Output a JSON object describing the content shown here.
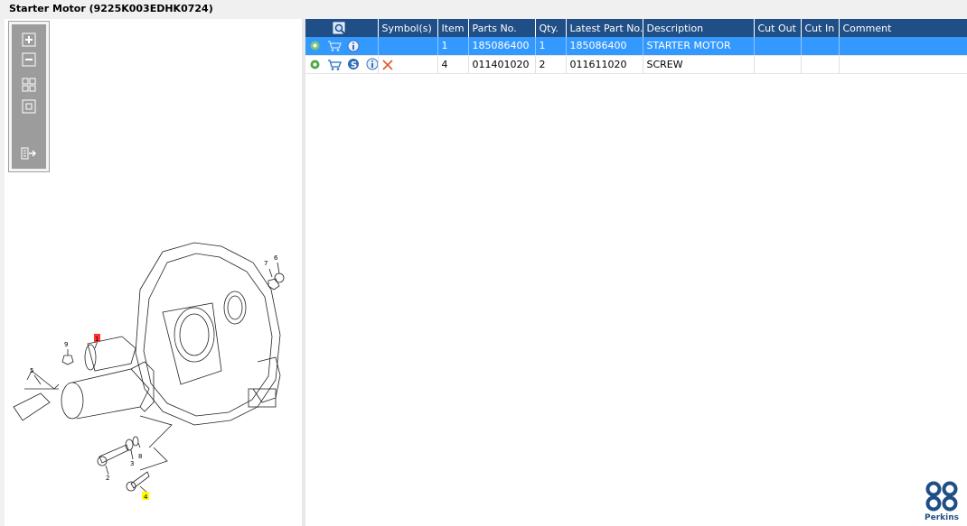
{
  "window": {
    "title": "Starter Motor (9225K003EDHK0724)"
  },
  "toolbar": {
    "buttons": [
      {
        "name": "zoom-in",
        "icon": "zoom-in-icon"
      },
      {
        "name": "zoom-out",
        "icon": "zoom-out-icon"
      },
      {
        "name": "fit-all",
        "icon": "fit-all-icon"
      },
      {
        "name": "fit-window",
        "icon": "fit-window-icon"
      },
      {
        "name": "export",
        "icon": "export-icon"
      }
    ]
  },
  "diagram": {
    "callouts": [
      "1",
      "2",
      "3",
      "4",
      "5",
      "6",
      "7",
      "8",
      "9"
    ],
    "highlight_colors": {
      "item1": "#ff3333",
      "item4": "#ffff00"
    }
  },
  "grid": {
    "columns": [
      "",
      "Symbol(s)",
      "Item",
      "Parts No.",
      "Qty.",
      "Latest Part No.",
      "Description",
      "Cut Out",
      "Cut In",
      "Comment"
    ],
    "rows": [
      {
        "item": "1",
        "parts_no": "185086400",
        "qty": "1",
        "latest": "185086400",
        "description": "STARTER MOTOR",
        "cut_out": "",
        "cut_in": "",
        "comment": "",
        "selected": true
      },
      {
        "item": "4",
        "parts_no": "011401020",
        "qty": "2",
        "latest": "011611020",
        "description": "SCREW",
        "cut_out": "",
        "cut_in": "",
        "comment": "",
        "selected": false
      }
    ]
  },
  "brand": {
    "name": "Perkins",
    "color": "#1f4f86"
  },
  "colors": {
    "header": "#1f4f86",
    "selection": "#3399ff"
  }
}
